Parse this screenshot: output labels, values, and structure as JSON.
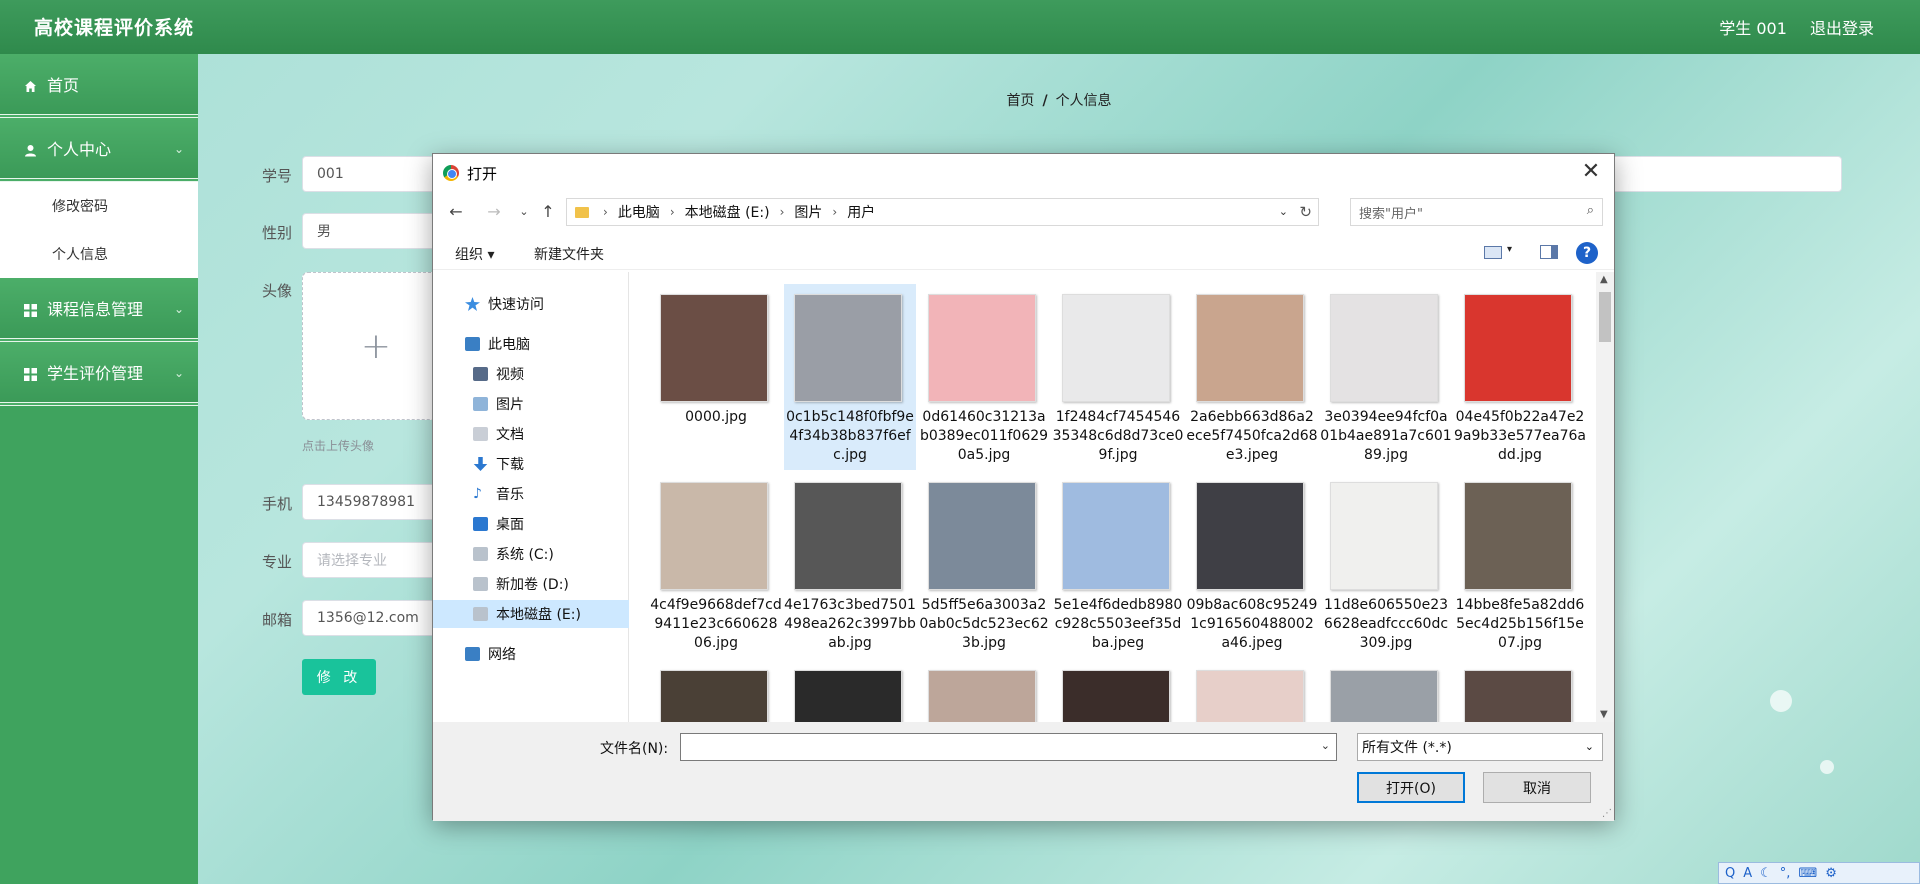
{
  "app": {
    "title": "高校课程评价系统",
    "user": "学生 001",
    "logout": "退出登录"
  },
  "sidebar": {
    "home": "首页",
    "personal_center": "个人中心",
    "sub_items": [
      "修改密码",
      "个人信息"
    ],
    "course_mgmt": "课程信息管理",
    "eval_mgmt": "学生评价管理"
  },
  "breadcrumb": {
    "home": "首页",
    "sep": "/",
    "current": "个人信息"
  },
  "form": {
    "student_id_label": "学号",
    "student_id": "001",
    "gender_label": "性别",
    "gender": "男",
    "avatar_label": "头像",
    "upload_plus": "+",
    "upload_hint": "点击上传头像",
    "phone_label": "手机",
    "phone": "13459878981",
    "major_label": "专业",
    "major_placeholder": "请选择专业",
    "email_label": "邮箱",
    "email": "1356@12.com",
    "submit": "修 改"
  },
  "dialog": {
    "title": "打开",
    "close": "✕",
    "path": [
      "此电脑",
      "本地磁盘 (E:)",
      "图片",
      "用户"
    ],
    "search_placeholder": "搜索\"用户\"",
    "toolbar": {
      "organize": "组织 ▾",
      "new_folder": "新建文件夹",
      "help": "?"
    },
    "nav_pane": [
      "快速访问",
      "此电脑",
      "视频",
      "图片",
      "文档",
      "下载",
      "音乐",
      "桌面",
      "系统 (C:)",
      "新加卷 (D:)",
      "本地磁盘 (E:)",
      "网络"
    ],
    "files": [
      "0000.jpg",
      "0c1b5c148f0fbf9e4f34b38b837f6efc.jpg",
      "0d61460c31213ab0389ec011f06290a5.jpg",
      "1f2484cf745454635348c6d8d73ce09f.jpg",
      "2a6ebb663d86a2ece5f7450fca2d68e3.jpeg",
      "3e0394ee94fcf0a01b4ae891a7c60189.jpg",
      "04e45f0b22a47e29a9b33e577ea76add.jpg",
      "4c4f9e9668def7cd9411e23c66062806.jpg",
      "4e1763c3bed7501498ea262c3997bbab.jpg",
      "5d5ff5e6a3003a20ab0c5dc523ec623b.jpg",
      "5e1e4f6dedb8980c928c5503eef35dba.jpeg",
      "09b8ac608c952491c916560488002a46.jpeg",
      "11d8e606550e236628eadfccc60dc309.jpg",
      "14bbe8fe5a82dd65ec4d25b156f15e07.jpg",
      "",
      "",
      "",
      "",
      "",
      "",
      ""
    ],
    "file_name_label": "文件名(N):",
    "file_name_value": "",
    "file_type": "所有文件 (*.*)",
    "open": "打开(O)",
    "cancel": "取消"
  },
  "colors": {
    "header": "#3e9b5c",
    "sidebar": "#3fa35e",
    "submit": "#19c39b",
    "selection": "#d9ebfb"
  }
}
